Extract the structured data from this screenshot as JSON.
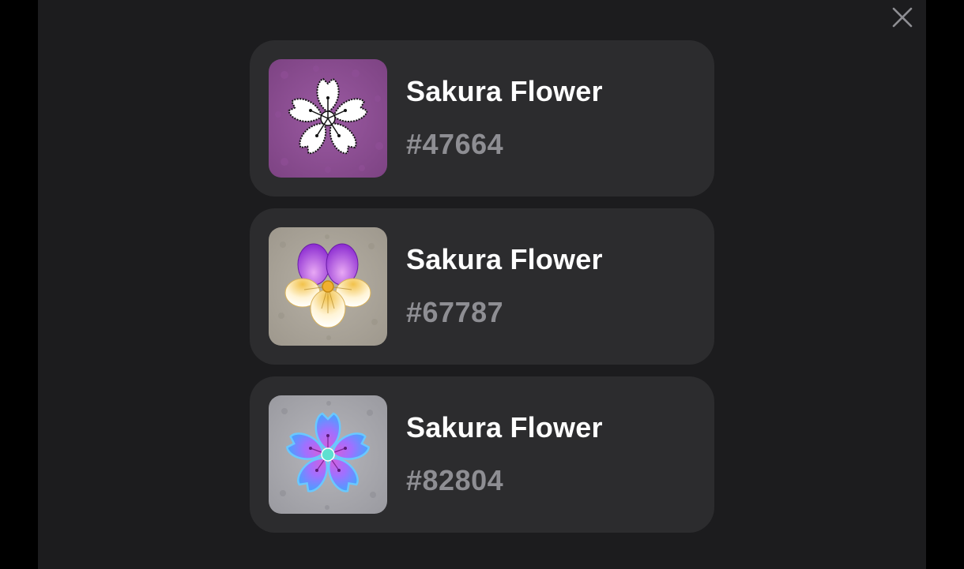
{
  "close_button": {
    "icon": "close-icon",
    "color": "#8e8e93"
  },
  "colors": {
    "background": "#000000",
    "modal_background": "#1c1c1e",
    "card_background": "#2c2c2e",
    "title_color": "#ffffff",
    "id_color": "#8e8e93"
  },
  "items": [
    {
      "title": "Sakura Flower",
      "id": "#47664",
      "icon": "white-sakura-flower-icon",
      "tile_color": "#8a4e90"
    },
    {
      "title": "Sakura Flower",
      "id": "#67787",
      "icon": "purple-yellow-pansy-flower-icon",
      "tile_color": "#a8a298"
    },
    {
      "title": "Sakura Flower",
      "id": "#82804",
      "icon": "blue-pink-sakura-flower-icon",
      "tile_color": "#a9a9ae"
    }
  ]
}
